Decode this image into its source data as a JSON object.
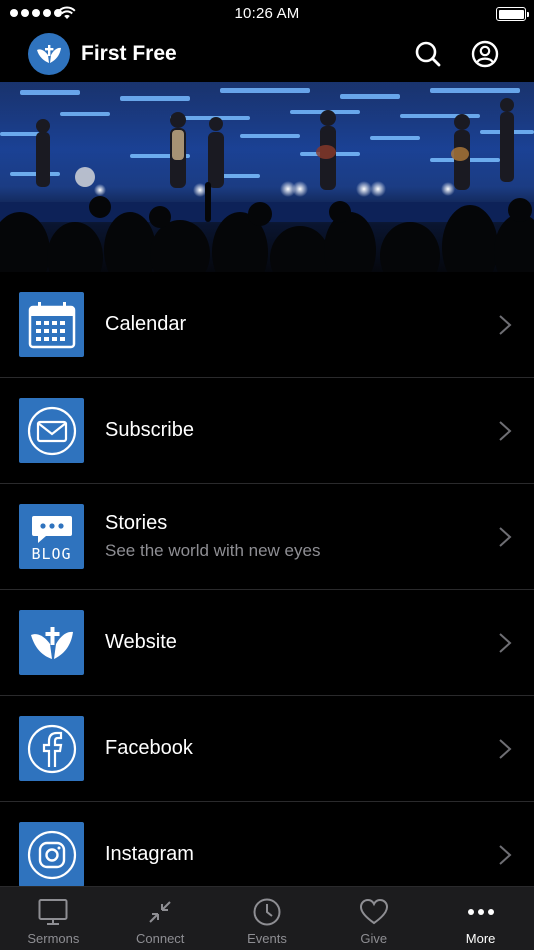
{
  "status_bar": {
    "time": "10:26 AM"
  },
  "header": {
    "title": "First Free"
  },
  "menu": {
    "items": [
      {
        "label": "Calendar",
        "subtitle": "",
        "icon": "calendar-icon"
      },
      {
        "label": "Subscribe",
        "subtitle": "",
        "icon": "mail-icon"
      },
      {
        "label": "Stories",
        "subtitle": "See the world with new eyes",
        "icon": "blog-icon",
        "icon_text": "BLOG"
      },
      {
        "label": "Website",
        "subtitle": "",
        "icon": "church-logo-icon"
      },
      {
        "label": "Facebook",
        "subtitle": "",
        "icon": "facebook-icon"
      },
      {
        "label": "Instagram",
        "subtitle": "",
        "icon": "instagram-icon"
      }
    ]
  },
  "tabs": [
    {
      "label": "Sermons",
      "icon": "tv-icon",
      "active": false
    },
    {
      "label": "Connect",
      "icon": "connect-icon",
      "active": false
    },
    {
      "label": "Events",
      "icon": "clock-icon",
      "active": false
    },
    {
      "label": "Give",
      "icon": "heart-icon",
      "active": false
    },
    {
      "label": "More",
      "icon": "more-icon",
      "active": true
    }
  ],
  "colors": {
    "accent": "#2f73be",
    "background": "#000000",
    "tabbar": "#1c1c1e",
    "muted": "#8e8e93"
  }
}
